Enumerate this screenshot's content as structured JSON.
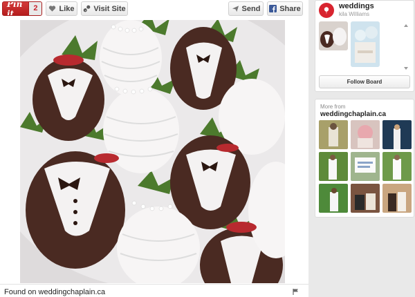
{
  "toolbar": {
    "pinit_label": "Pin it",
    "pinit_count": "2",
    "like_label": "Like",
    "visit_label": "Visit Site",
    "send_label": "Send",
    "share_label": "Share"
  },
  "pin": {
    "image_alt": "Tuxedo and gown chocolate covered strawberries",
    "found_on": "Found on weddingchaplain.ca"
  },
  "board": {
    "name": "weddings",
    "owner": "kila Williams",
    "follow_label": "Follow Board"
  },
  "more_from": {
    "label": "More from",
    "source": "weddingchaplain.ca"
  },
  "colors": {
    "brand_red": "#c9232d",
    "facebook_blue": "#3b5998"
  },
  "icons": [
    "heart-icon",
    "link-icon",
    "send-icon",
    "facebook-icon",
    "flag-icon",
    "pin-icon"
  ]
}
